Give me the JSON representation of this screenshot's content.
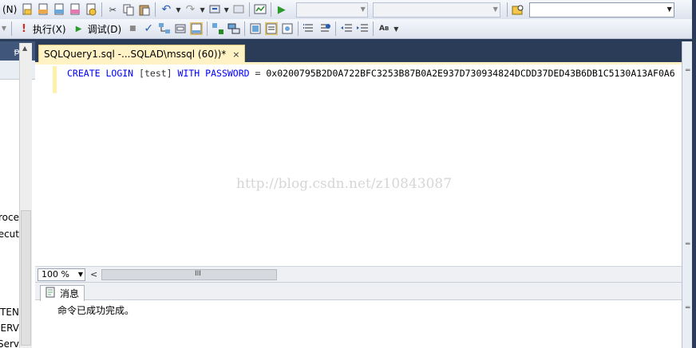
{
  "toolbar1": {
    "menu_fragment": "(N)",
    "combo1": "",
    "combo2": "",
    "combo3": ""
  },
  "toolbar2": {
    "execute_label": "执行(X)",
    "debug_label": "调试(D)",
    "debug_icon": "play-triangle-icon"
  },
  "object_explorer": {
    "pin_glyph": "ᵽ",
    "close_glyph": "×",
    "items": [
      "roce",
      "ecut",
      "STEN",
      "SERV",
      "Serv"
    ]
  },
  "document_tab": {
    "title": "SQLQuery1.sql -...SQLAD\\mssql (60))*",
    "close_glyph": "×"
  },
  "editor": {
    "kw_create": "CREATE",
    "kw_login": "LOGIN",
    "login_name": "[test]",
    "kw_with": "WITH",
    "kw_password": "PASSWORD",
    "op": "=",
    "hash_value": "0x0200795B2D0A722BFC3253B87B0A2E937D730934824DCDD37DED43B6DB1C5130A13AF0A6",
    "watermark": "http://blog.csdn.net/z10843087"
  },
  "status": {
    "zoom": "100 %",
    "scroll_left_glyph": "<",
    "scroll_grip_glyph": "III"
  },
  "results": {
    "tab_label": "消息",
    "message": "命令已成功完成。"
  },
  "colors": {
    "frame": "#2b3c59",
    "tab_active": "#fff2c4",
    "keyword": "#0000ff"
  }
}
